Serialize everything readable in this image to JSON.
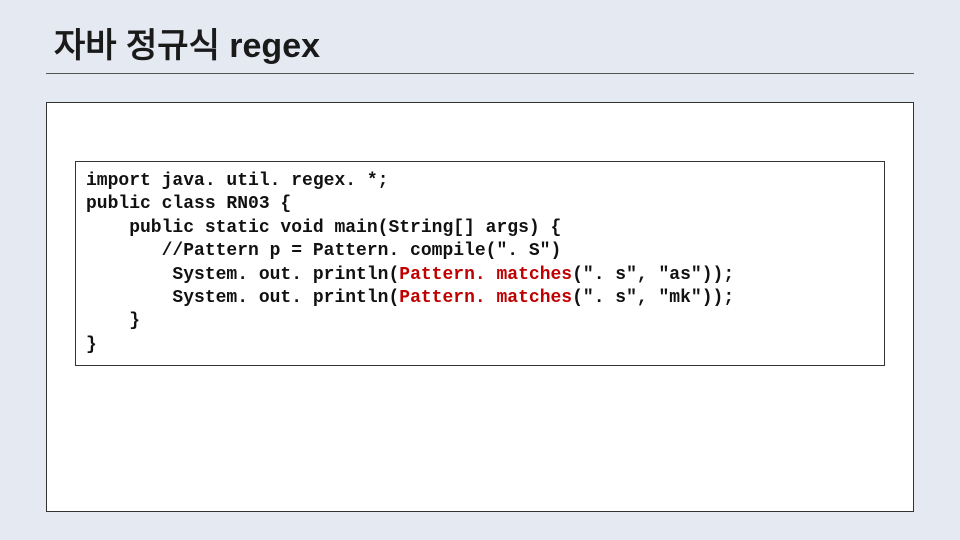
{
  "title": "자바 정규식 regex",
  "code": {
    "l1": "import java. util. regex. *;",
    "l2": "public class RN03 {",
    "l3": "    public static void main(String[] args) {",
    "l4": "       //Pattern p = Pattern. compile(\". S\")",
    "l5a": "        System. out. println(",
    "l5h": "Pattern. matches",
    "l5b": "(\". s\", \"as\"));",
    "l6a": "        System. out. println(",
    "l6h": "Pattern. matches",
    "l6b": "(\". s\", \"mk\"));",
    "l7": "    }",
    "l8": "}"
  }
}
